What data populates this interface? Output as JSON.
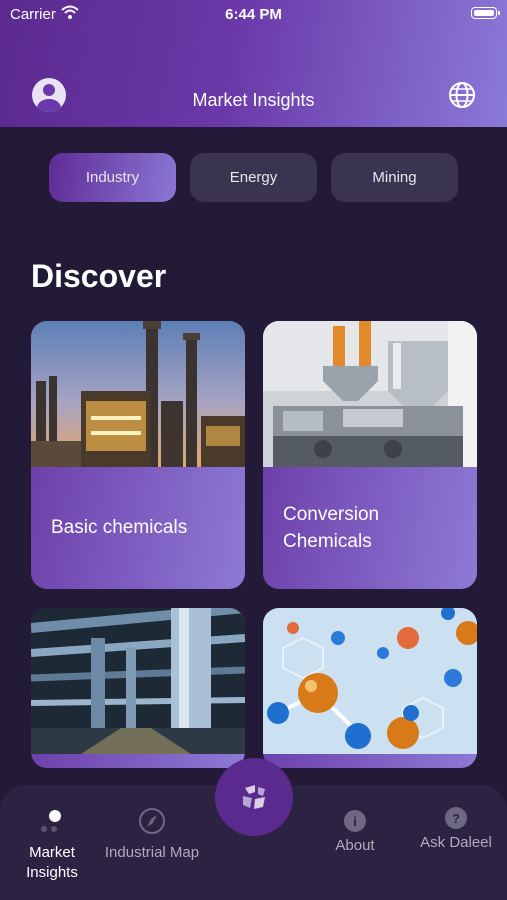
{
  "status_bar": {
    "carrier": "Carrier",
    "time": "6:44 PM"
  },
  "header": {
    "title": "Market Insights",
    "avatar_icon": "user-avatar-icon",
    "language_icon": "globe-icon"
  },
  "tabs": [
    {
      "label": "Industry",
      "active": true
    },
    {
      "label": "Energy",
      "active": false
    },
    {
      "label": "Mining",
      "active": false
    }
  ],
  "section": {
    "title": "Discover"
  },
  "cards": [
    {
      "label": "Basic chemicals",
      "image": "refinery-photo"
    },
    {
      "label": "Conversion Chemicals",
      "image": "machinery-photo"
    },
    {
      "label": "",
      "image": "pipes-photo"
    },
    {
      "label": "",
      "image": "molecules-photo"
    }
  ],
  "bottom_nav": {
    "items": [
      {
        "label": "Market Insights",
        "icon": "dots-icon",
        "active": true
      },
      {
        "label": "Industrial Map",
        "icon": "compass-icon",
        "active": false
      },
      {
        "label": "About",
        "icon": "info-icon",
        "glyph": "i",
        "active": false
      },
      {
        "label": "Ask Daleel",
        "icon": "question-icon",
        "glyph": "?",
        "active": false
      }
    ],
    "center_icon": "daleel-logo-icon"
  },
  "colors": {
    "accent": "#6a38a8",
    "accent_light": "#8d7ad5",
    "background": "#221a36",
    "nav_bg": "#2c2342"
  }
}
